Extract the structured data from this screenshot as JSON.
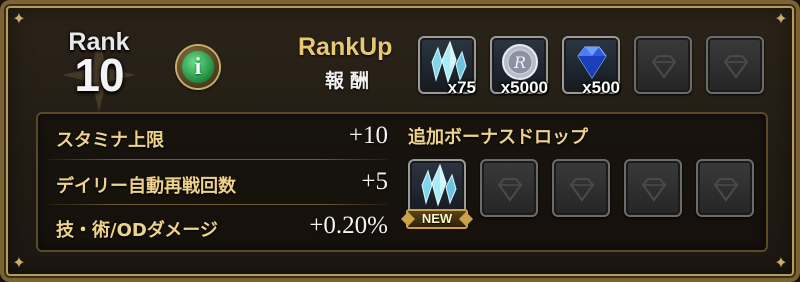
{
  "rank": {
    "label": "Rank",
    "number": "10"
  },
  "info_button": {
    "icon": "info-icon",
    "glyph": "i",
    "color": "#2a9a48"
  },
  "rankup": {
    "title": "RankUp",
    "subtitle": "報酬",
    "rewards": [
      {
        "icon": "crystal-icon",
        "quantity": "x75"
      },
      {
        "icon": "silver-coin-icon",
        "quantity": "x5000"
      },
      {
        "icon": "blue-diamond-icon",
        "quantity": "x500"
      },
      {
        "icon": "empty-slot-icon",
        "quantity": ""
      },
      {
        "icon": "empty-slot-icon",
        "quantity": ""
      }
    ]
  },
  "stats": [
    {
      "label": "スタミナ上限",
      "value": "+10"
    },
    {
      "label": "デイリー自動再戦回数",
      "value": "+5"
    },
    {
      "label": "技・術/ODダメージ",
      "value": "+0.20%"
    }
  ],
  "bonus_drop": {
    "title": "追加ボーナスドロップ",
    "items": [
      {
        "icon": "crystal-icon",
        "badge": "NEW"
      },
      {
        "icon": "empty-slot-icon",
        "badge": ""
      },
      {
        "icon": "empty-slot-icon",
        "badge": ""
      },
      {
        "icon": "empty-slot-icon",
        "badge": ""
      },
      {
        "icon": "empty-slot-icon",
        "badge": ""
      }
    ]
  },
  "colors": {
    "accent_gold": "#e8c876",
    "label_gold": "#efd38c",
    "frame": "#b59a5c"
  }
}
